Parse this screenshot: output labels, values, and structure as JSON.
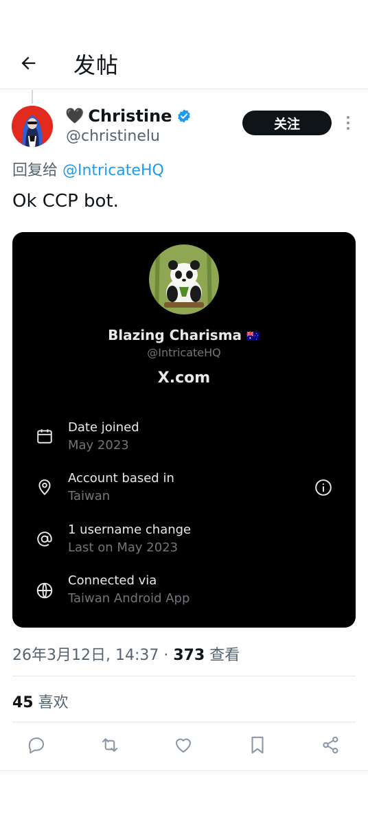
{
  "header": {
    "title": "发帖",
    "back_icon": "arrow-left-icon"
  },
  "author": {
    "emoji": "🖤",
    "name": "Christine",
    "handle": "@christinelu",
    "verified_color": "#1d9bf0"
  },
  "follow_label": "关注",
  "reply": {
    "prefix": "回复给 ",
    "mention": "@IntricateHQ"
  },
  "tweet_text": "Ok CCP bot.",
  "card": {
    "name": "Blazing Charisma",
    "flag": "🇦🇺",
    "handle": "@IntricateHQ",
    "site": "X.com",
    "rows": [
      {
        "icon": "calendar-icon",
        "title": "Date joined",
        "sub": "May 2023"
      },
      {
        "icon": "location-pin-icon",
        "title": "Account based in",
        "sub": "Taiwan"
      },
      {
        "icon": "at-sign-icon",
        "title": "1 username change",
        "sub": "Last on May 2023"
      },
      {
        "icon": "globe-icon",
        "title": "Connected via",
        "sub": "Taiwan Android App"
      }
    ]
  },
  "meta": {
    "datetime": "26年3月12日, 14:37",
    "separator": " · ",
    "views_count": "373",
    "views_label": " 查看"
  },
  "likes": {
    "count": "45",
    "label": " 喜欢"
  },
  "actions": [
    "reply-icon",
    "repost-icon",
    "like-icon",
    "bookmark-icon",
    "share-icon"
  ],
  "colors": {
    "accent": "#1d9bf0",
    "text": "#0f1419",
    "muted": "#536471",
    "card_bg": "#000000"
  }
}
